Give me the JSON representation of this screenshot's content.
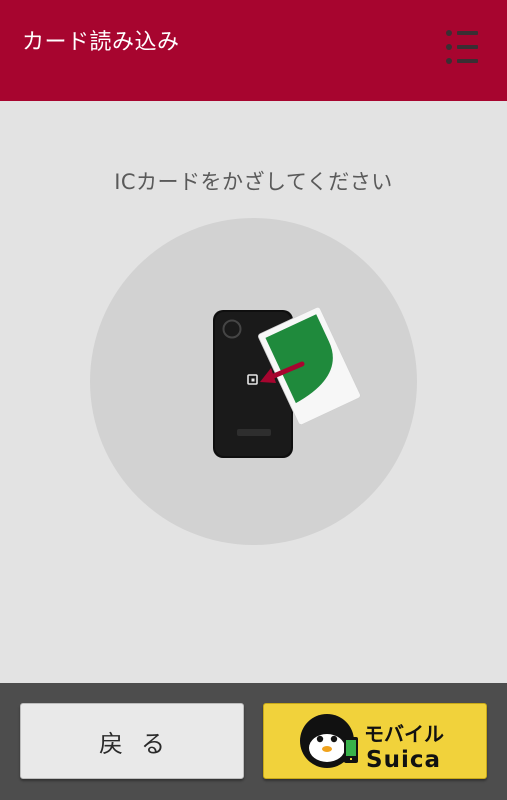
{
  "header": {
    "title": "カード読み込み",
    "menu_icon": "list-menu-icon"
  },
  "main": {
    "instruction": "ICカードをかざしてください",
    "illustration_icon": "phone-card-tap-icon"
  },
  "footer": {
    "back_label": "戻る",
    "mobile_suica": {
      "line1": "モバイル",
      "line2": "Suica",
      "icon": "suica-penguin-logo-icon"
    }
  },
  "colors": {
    "header_bg": "#a7052f",
    "body_bg": "#e3e3e3",
    "footer_bg": "#4d4d4d",
    "suica_button_bg": "#f1d23b",
    "card_green": "#1f8a3c"
  }
}
